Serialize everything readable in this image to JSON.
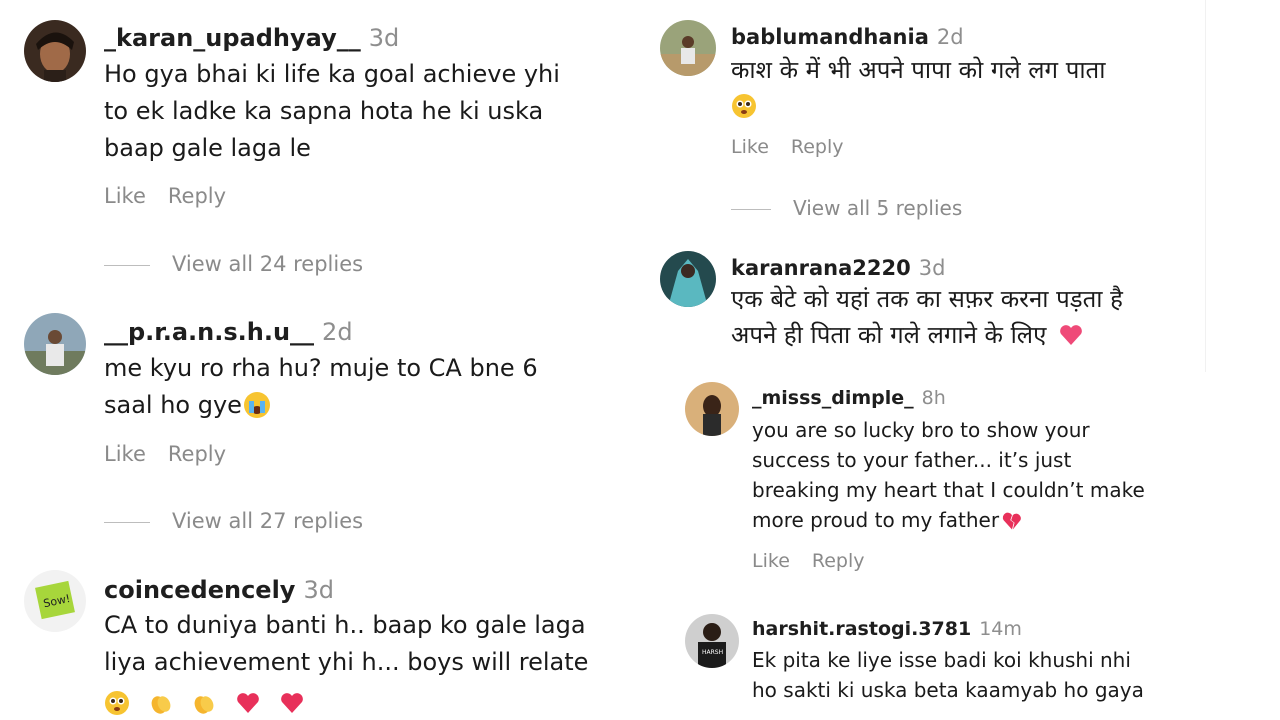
{
  "left_comments": [
    {
      "username": "_karan_upadhyay__",
      "time": "3d",
      "lines": [
        "Ho gya bhai ki life ka goal achieve yhi",
        "to ek ladke ka sapna hota he ki uska",
        "baap gale laga le"
      ],
      "like": "Like",
      "reply": "Reply",
      "view_replies": "View all 24 replies"
    },
    {
      "username": "__p.r.a.n.s.h.u__",
      "time": "2d",
      "lines": [
        "me kyu ro rha hu? muje to CA bne 6",
        "saal ho gye"
      ],
      "emoji": [
        "loudly-crying-face"
      ],
      "like": "Like",
      "reply": "Reply",
      "view_replies": "View all 27 replies"
    },
    {
      "username": "coincedencely",
      "time": "3d",
      "lines": [
        "CA to duniya banti h.. baap ko gale laga",
        "liya achievement yhi h... boys will relate"
      ],
      "emoji": [
        "pleading-face",
        "clapping-hands",
        "clapping-hands",
        "red-heart",
        "red-heart"
      ]
    }
  ],
  "right_comments": [
    {
      "username": "bablumandhania",
      "time": "2d",
      "lines": [
        "काश के में भी अपने पापा को गले लग पाता"
      ],
      "emoji": [
        "pleading-face"
      ],
      "like": "Like",
      "reply": "Reply",
      "view_replies": "View all 5 replies"
    },
    {
      "username": "karanrana2220",
      "time": "3d",
      "lines": [
        "एक बेटे को यहां तक का सफ़र करना पड़ता है",
        "अपने ही पिता को गले लगाने के लिए"
      ],
      "emoji": [
        "pink-heart"
      ]
    }
  ],
  "replies": [
    {
      "username": "_misss_dimple_",
      "time": "8h",
      "lines": [
        "you are so lucky bro to show your",
        "success to your father... it’s just",
        "breaking my heart that I couldn’t make",
        "more proud to my father"
      ],
      "emoji": [
        "broken-heart"
      ],
      "like": "Like",
      "reply": "Reply"
    },
    {
      "username": "harshit.rastogi.3781",
      "time": "14m",
      "lines": [
        "Ek pita ke liye isse badi koi khushi nhi",
        "ho sakti ki uska beta kaamyab ho gaya"
      ]
    }
  ],
  "colors": {
    "username": "#1e1e1e",
    "meta": "#8e8e8e",
    "heart": "#e8305a",
    "emoji_yellow": "#f7c431"
  }
}
